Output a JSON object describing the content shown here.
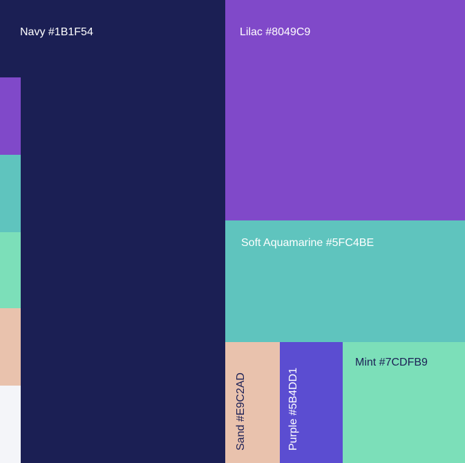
{
  "palette": [
    {
      "id": "navy",
      "label": "Navy #1B1F54",
      "color": "#1B1F54",
      "text_color": "#FFFFFF"
    },
    {
      "id": "lilac",
      "label": "Lilac #8049C9",
      "color": "#8049C9",
      "text_color": "#FFFFFF"
    },
    {
      "id": "aqua",
      "label": "Soft Aquamarine #5FC4BE",
      "color": "#5FC4BE",
      "text_color": "#FFFFFF"
    },
    {
      "id": "sand",
      "label": "Sand #E9C2AD",
      "color": "#E9C2AD",
      "text_color": "#1B1F54"
    },
    {
      "id": "purple",
      "label": "Purple #5B4DD1",
      "color": "#5B4DD1",
      "text_color": "#FFFFFF"
    },
    {
      "id": "mint",
      "label": "Mint #7CDFB9",
      "color": "#7CDFB9",
      "text_color": "#1B1F54"
    }
  ],
  "strip_colors": [
    "#8049C9",
    "#5FC4BE",
    "#7CDFB9",
    "#E9C2AD",
    "#F4F5F9"
  ]
}
